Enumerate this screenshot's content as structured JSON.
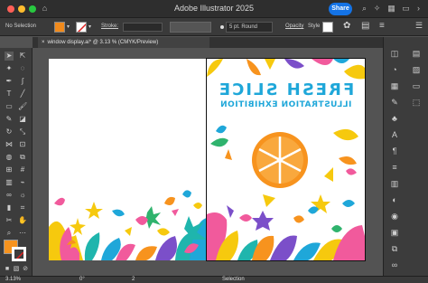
{
  "app": {
    "title": "Adobe Illustrator 2025",
    "share_label": "Share"
  },
  "control_bar": {
    "selection_label": "No Selection",
    "fill_color": "#f08a1c",
    "stroke_label": "Stroke:",
    "brush_value": "5 pt. Round",
    "opacity_label": "Opacity",
    "style_label": "Style"
  },
  "document_tab": {
    "label": "window display.ai* @ 3.13 % (CMYK/Preview)"
  },
  "artwork": {
    "headline": "FRESH SLICE",
    "subheadline": "ILLUSTRATION EXHIBITION"
  },
  "status_bar": {
    "zoom": "3.13%",
    "rotation": "0°",
    "artboard": "2",
    "tool": "Selection"
  },
  "colors": {
    "accent": "#1473e6",
    "orange": "#f7931e",
    "pink": "#f15a9c",
    "teal": "#1fb5ad",
    "purple": "#7b4fc9",
    "yellow": "#f6c90e",
    "cyan": "#1fa7d9",
    "green": "#2fb36d"
  }
}
